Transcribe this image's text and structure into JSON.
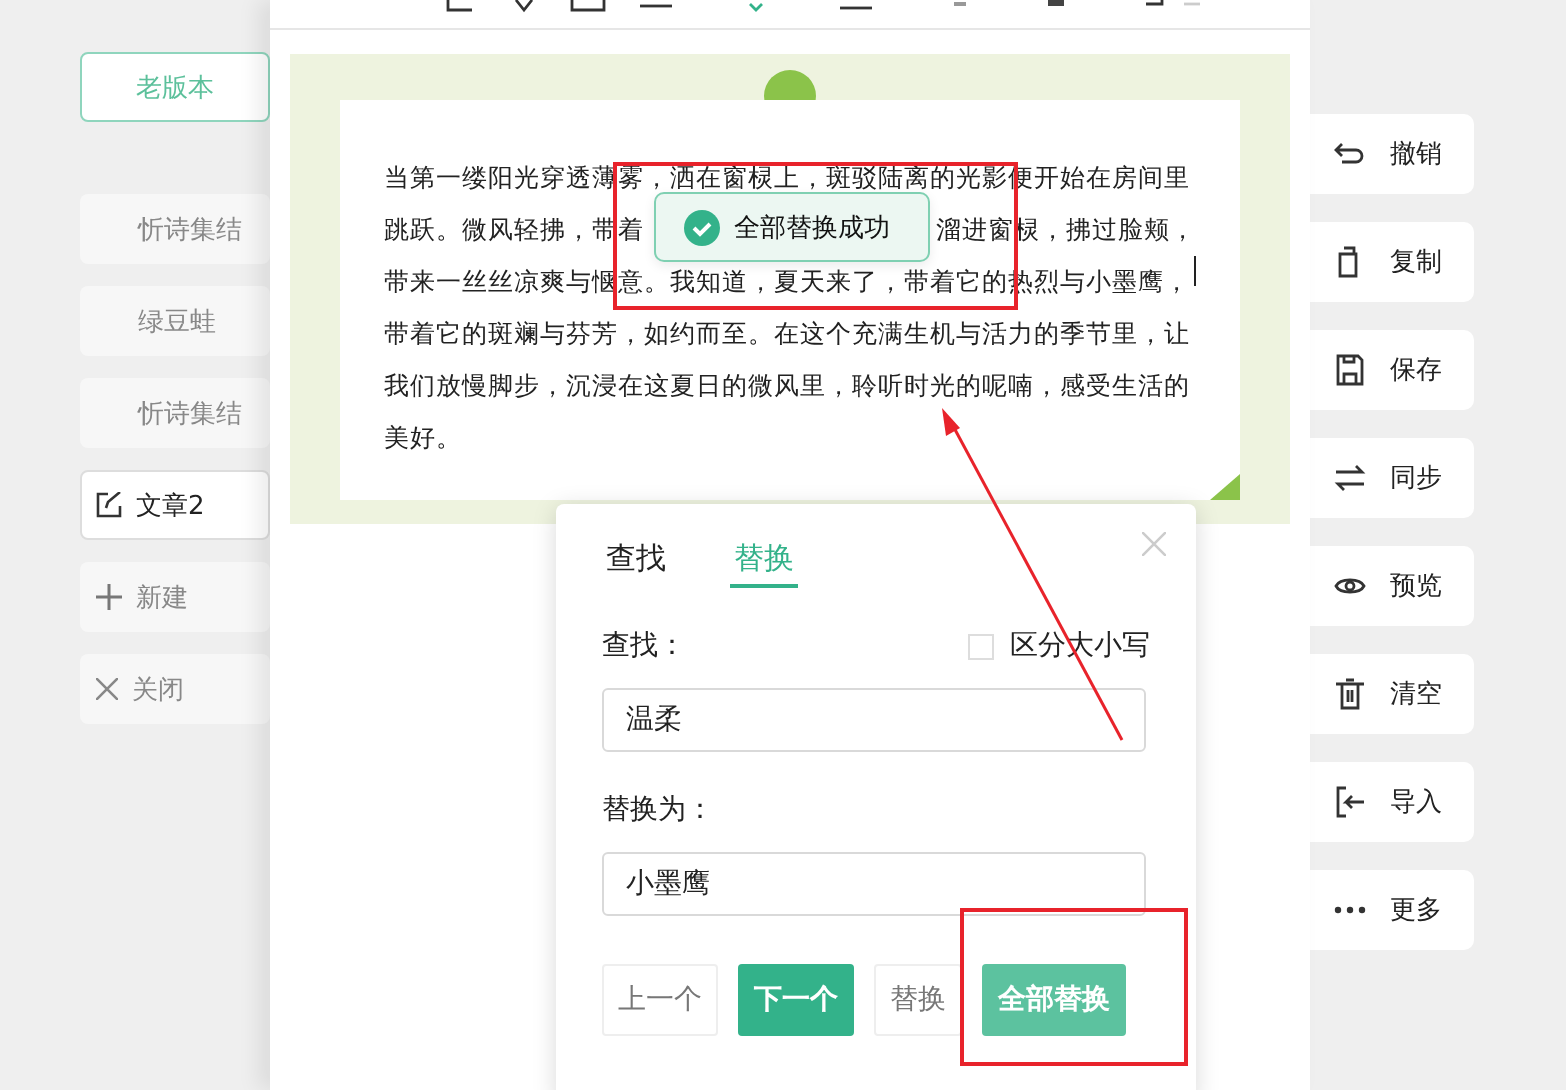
{
  "sidebar": {
    "version_button": "老版本",
    "items": [
      {
        "label": "忻诗集结",
        "kind": "doc",
        "selected": false
      },
      {
        "label": "绿豆蛙",
        "kind": "doc",
        "selected": false
      },
      {
        "label": "忻诗集结",
        "kind": "doc",
        "selected": false
      },
      {
        "label": "文章2",
        "kind": "edit",
        "selected": true
      },
      {
        "label": "新建",
        "kind": "add",
        "selected": false
      },
      {
        "label": "关闭",
        "kind": "close",
        "selected": false
      }
    ]
  },
  "document": {
    "lines": [
      {
        "segments": [
          "当第一缕阳光穿透薄雾，洒在窗棂上，斑驳陆离的光影便开始在房间里"
        ],
        "cursor": false
      },
      {
        "segments": [
          "跳跃。微风轻拂，带着",
          "溜进窗棂，拂过脸颊，"
        ],
        "cursor": false
      },
      {
        "segments": [
          "带来一丝丝凉爽与惬意。我知道，夏天来了，带着它的热烈与小墨鹰，"
        ],
        "cursor": true
      },
      {
        "segments": [
          "带着它的斑斓与芬芳，如约而至。在这个充满生机与活力的季节里，让"
        ],
        "cursor": false
      },
      {
        "segments": [
          "我们放慢脚步，沉浸在这夏日的微风里，聆听时光的呢喃，感受生活的"
        ],
        "cursor": false
      },
      {
        "segments": [
          "美好。"
        ],
        "cursor": false
      }
    ]
  },
  "toast": {
    "message": "全部替换成功"
  },
  "dialog": {
    "tabs": [
      {
        "label": "查找",
        "selected": false
      },
      {
        "label": "替换",
        "selected": true
      }
    ],
    "find_label": "查找：",
    "case_option": {
      "label": "区分大小写",
      "checked": false
    },
    "find_value": "温柔",
    "replace_label": "替换为：",
    "replace_value": "小墨鹰",
    "buttons": [
      {
        "label": "上一个",
        "kind": "outline"
      },
      {
        "label": "下一个",
        "kind": "primary"
      },
      {
        "label": "替换",
        "kind": "outline"
      },
      {
        "label": "全部替换",
        "kind": "light"
      }
    ]
  },
  "actions": [
    {
      "label": "撤销",
      "kind": "undo"
    },
    {
      "label": "复制",
      "kind": "copy"
    },
    {
      "label": "保存",
      "kind": "save"
    },
    {
      "label": "同步",
      "kind": "sync"
    },
    {
      "label": "预览",
      "kind": "eye"
    },
    {
      "label": "清空",
      "kind": "trash"
    },
    {
      "label": "导入",
      "kind": "import"
    },
    {
      "label": "更多",
      "kind": "more"
    }
  ]
}
